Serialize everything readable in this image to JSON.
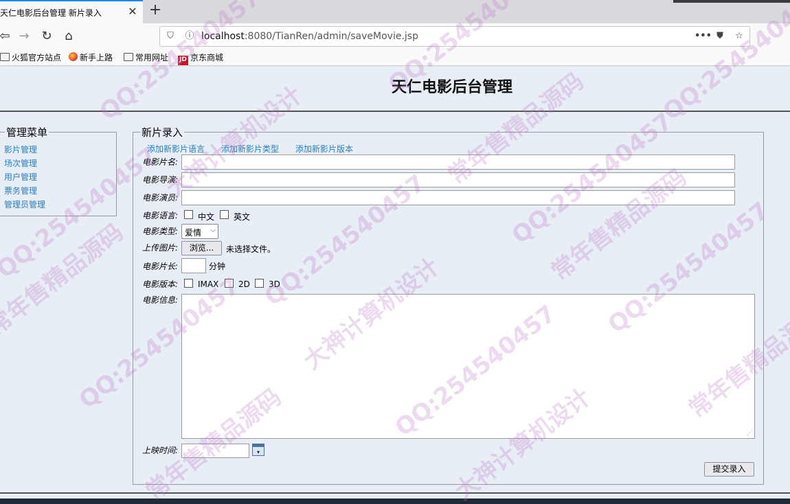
{
  "browser": {
    "tab_title": "天仁电影后台管理 新片录入",
    "url_host": "localhost",
    "url_rest": ":8080/TianRen/admin/saveMovie.jsp",
    "bookmarks": [
      "火狐官方站点",
      "新手上路",
      "常用网址",
      "京东商城"
    ],
    "jd_badge": "JD"
  },
  "header": {
    "title": "天仁电影后台管理"
  },
  "menu": {
    "legend": "管理菜单",
    "items": [
      "影片管理",
      "场次管理",
      "用户管理",
      "票务管理",
      "管理员管理"
    ]
  },
  "form": {
    "legend": "新片录入",
    "links": [
      "添加新影片语言",
      "添加新影片类型",
      "添加新影片版本"
    ],
    "labels": {
      "name": "电影片名:",
      "director": "电影导演:",
      "actors": "电影演员:",
      "language": "电影语言:",
      "type": "电影类型:",
      "poster": "上传图片:",
      "duration": "电影片长:",
      "version": "电影版本:",
      "info": "电影信息:",
      "release": "上映时间:"
    },
    "languages": [
      "中文",
      "英文"
    ],
    "type_selected": "爱情",
    "browse_label": "浏览...",
    "no_file_text": "未选择文件。",
    "duration_unit": "分钟",
    "versions": [
      "IMAX",
      "2D",
      "3D"
    ],
    "submit_label": "提交录入"
  },
  "watermark": [
    "QQ:254540457",
    "大神计算机设计",
    "常年售精品源码"
  ]
}
